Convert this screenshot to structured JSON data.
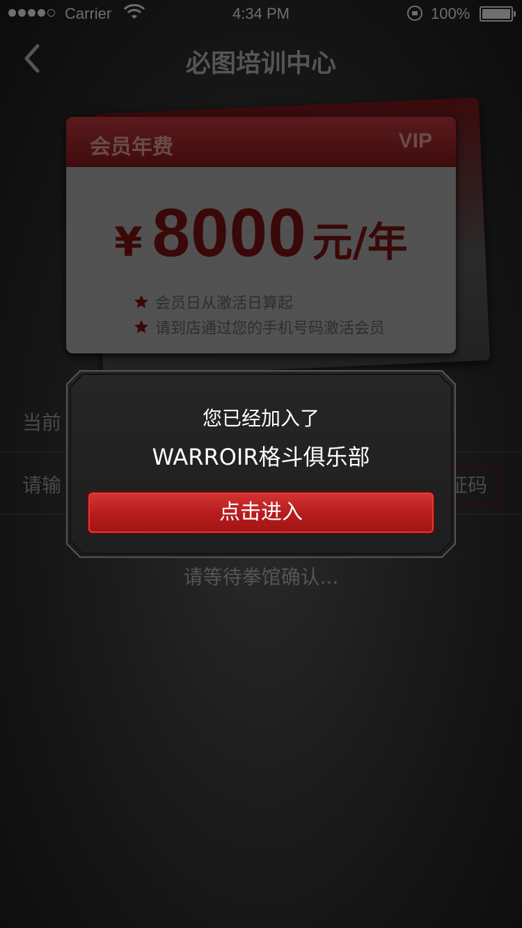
{
  "status_bar": {
    "carrier": "Carrier",
    "time": "4:34 PM",
    "battery": "100%"
  },
  "nav": {
    "title": "必图培训中心",
    "back_icon": "chevron-left-icon"
  },
  "vip_card": {
    "header_label": "会员年费",
    "badge": "VIP",
    "currency": "¥",
    "amount": "8000",
    "unit": "元/年",
    "notes": [
      "会员日从激活日算起",
      "请到店通过您的手机号码激活会员"
    ],
    "accent_color": "#3a0808"
  },
  "form": {
    "row1_label": "当前",
    "row2_label": "请输",
    "code_button": "证码",
    "waiting_text": "请等待拳馆确认..."
  },
  "dialog": {
    "line1": "您已经加入了",
    "line2": "WARROIR格斗俱乐部",
    "enter_button": "点击进入",
    "button_color": "#c12222"
  }
}
